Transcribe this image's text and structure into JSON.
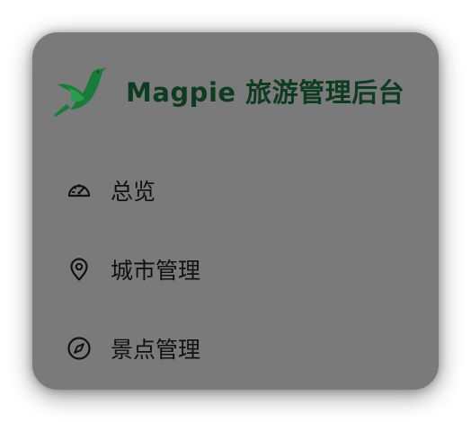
{
  "brand": {
    "title": "Magpie 旅游管理后台",
    "logo_icon": "magpie-bird-icon",
    "color": "#0f3b22"
  },
  "menu": {
    "items": [
      {
        "label": "总览",
        "icon": "dashboard-gauge-icon"
      },
      {
        "label": "城市管理",
        "icon": "map-pin-icon"
      },
      {
        "label": "景点管理",
        "icon": "compass-icon"
      }
    ]
  },
  "colors": {
    "panel_bg": "#7a7a7a",
    "logo_green": "#1a7a3a",
    "text": "#111111"
  }
}
